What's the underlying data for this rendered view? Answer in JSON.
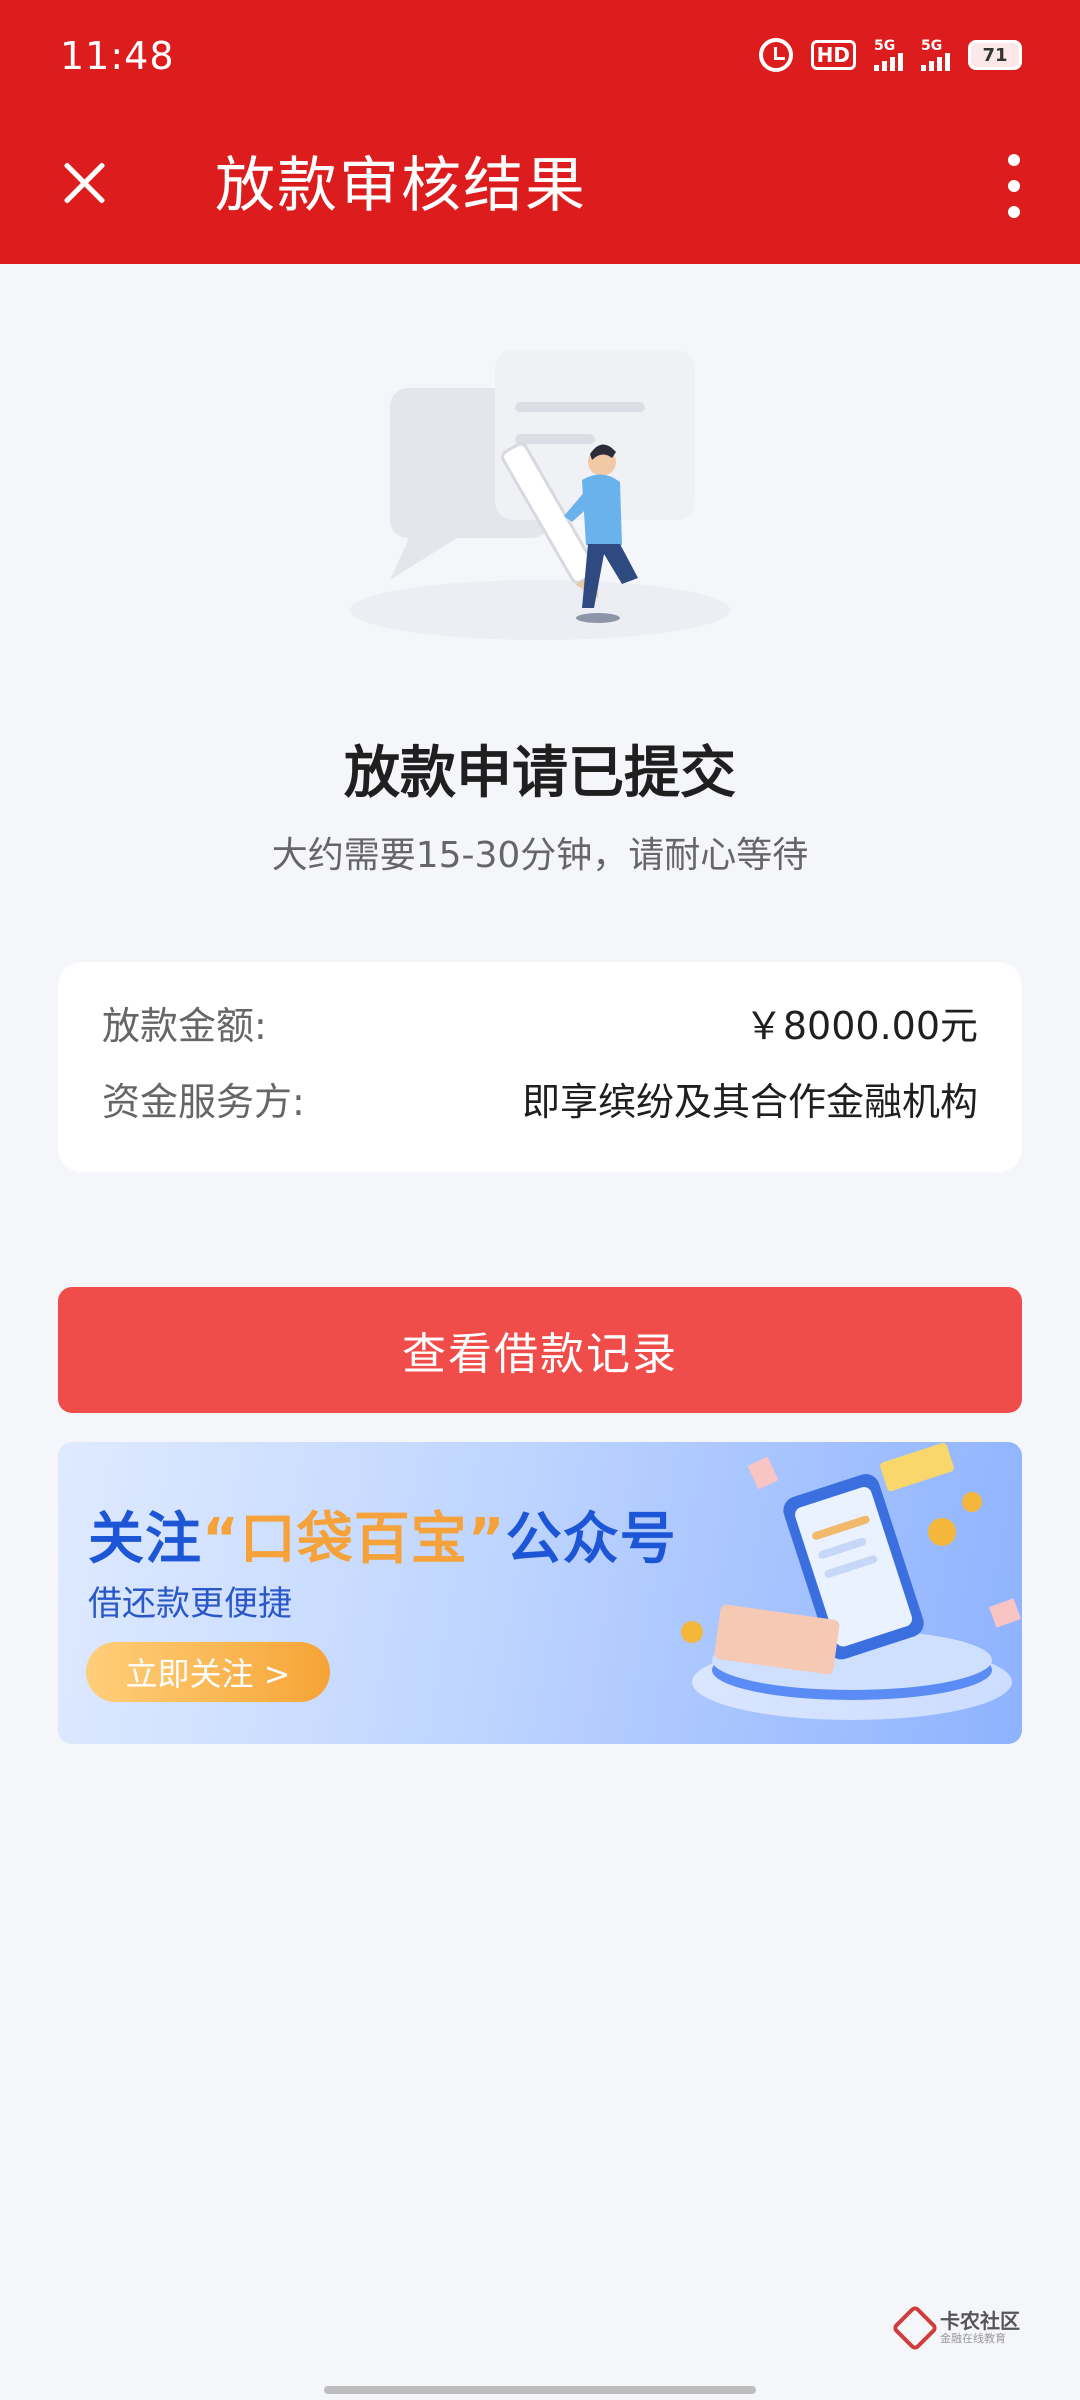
{
  "status_bar": {
    "time": "11:48",
    "hd_label": "HD",
    "network_1": "5G",
    "network_2": "5G",
    "battery_level": "71"
  },
  "app_bar": {
    "title": "放款审核结果",
    "close_icon": "close-icon",
    "more_icon": "more-vertical-icon"
  },
  "result": {
    "title": "放款申请已提交",
    "subtitle": "大约需要15-30分钟，请耐心等待"
  },
  "info": {
    "rows": [
      {
        "label": "放款金额:",
        "value": "￥8000.00元"
      },
      {
        "label": "资金服务方:",
        "value": "即享缤纷及其合作金融机构"
      }
    ]
  },
  "primary_button": {
    "label": "查看借款记录"
  },
  "banner": {
    "title_prefix": "关注",
    "title_highlight": "“口袋百宝”",
    "title_suffix": "公众号",
    "subtitle": "借还款更便捷",
    "button_label": "立即关注 >"
  },
  "watermark": {
    "name": "卡农社区",
    "tagline": "金融在线教育"
  },
  "colors": {
    "header_red": "#dc1c1d",
    "button_red": "#ef4c4a",
    "banner_blue": "#1c56d6",
    "banner_orange": "#f5a23a"
  }
}
